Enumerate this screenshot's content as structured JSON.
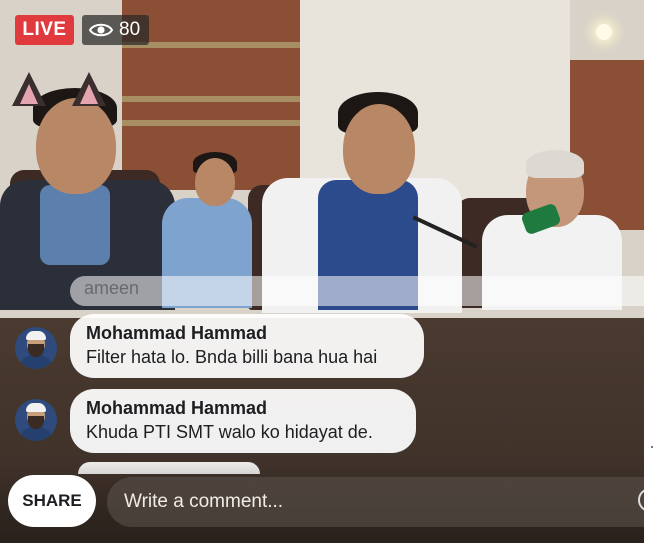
{
  "header": {
    "live_label": "LIVE",
    "viewer_count": "80",
    "viewer_icon": "eye-icon"
  },
  "comments": {
    "faded": {
      "text": "ameen"
    },
    "items": [
      {
        "author": "Mohammad Hammad",
        "text": "Filter hata lo. Bnda billi bana hua hai",
        "avatar_icon": "avatar"
      },
      {
        "author": "Mohammad Hammad",
        "text": "Khuda PTI SMT walo ko hidayat de.",
        "avatar_icon": "avatar"
      }
    ]
  },
  "composer": {
    "share_label": "SHARE",
    "placeholder": "Write a comment..."
  },
  "colors": {
    "live_red": "#e0393e",
    "bubble_white": "#ffffff"
  }
}
